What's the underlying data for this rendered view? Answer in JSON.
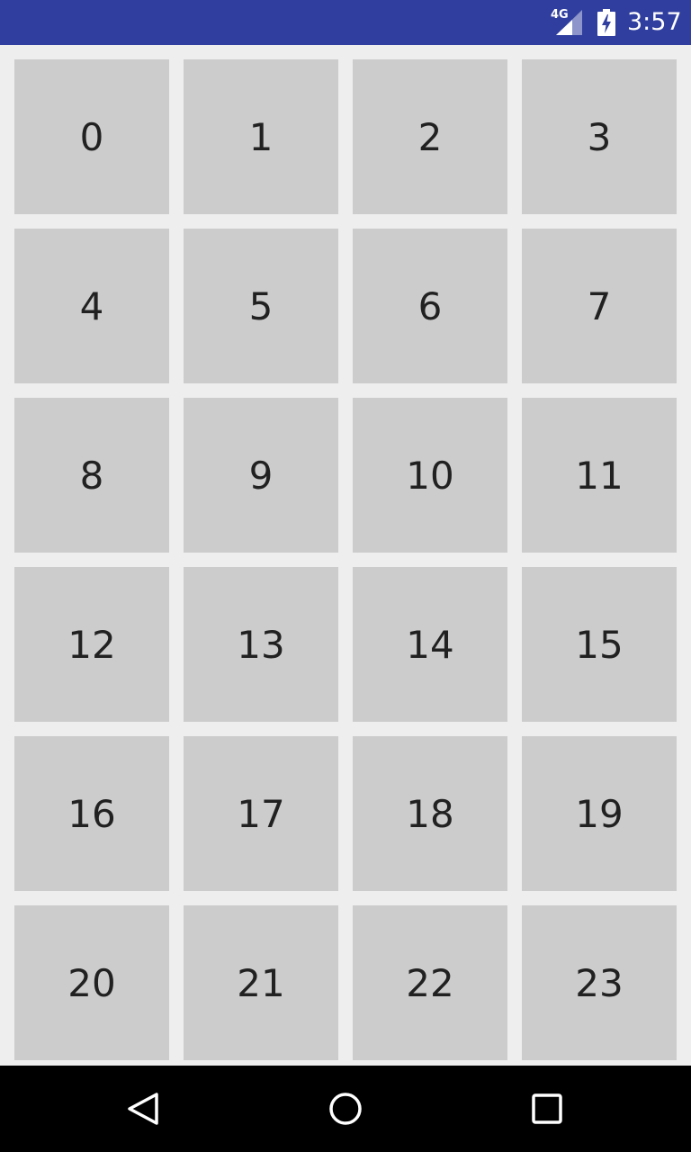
{
  "status_bar": {
    "network_type": "4G",
    "time": "3:57",
    "icons": [
      "signal-icon",
      "battery-charging-icon"
    ],
    "background_color": "#303F9F"
  },
  "grid": {
    "tile_color": "#CCCCCC",
    "text_color": "#212121",
    "items": [
      "0",
      "1",
      "2",
      "3",
      "4",
      "5",
      "6",
      "7",
      "8",
      "9",
      "10",
      "11",
      "12",
      "13",
      "14",
      "15",
      "16",
      "17",
      "18",
      "19",
      "20",
      "21",
      "22",
      "23"
    ]
  },
  "nav_bar": {
    "buttons": [
      "back-icon",
      "home-icon",
      "recents-icon"
    ]
  }
}
